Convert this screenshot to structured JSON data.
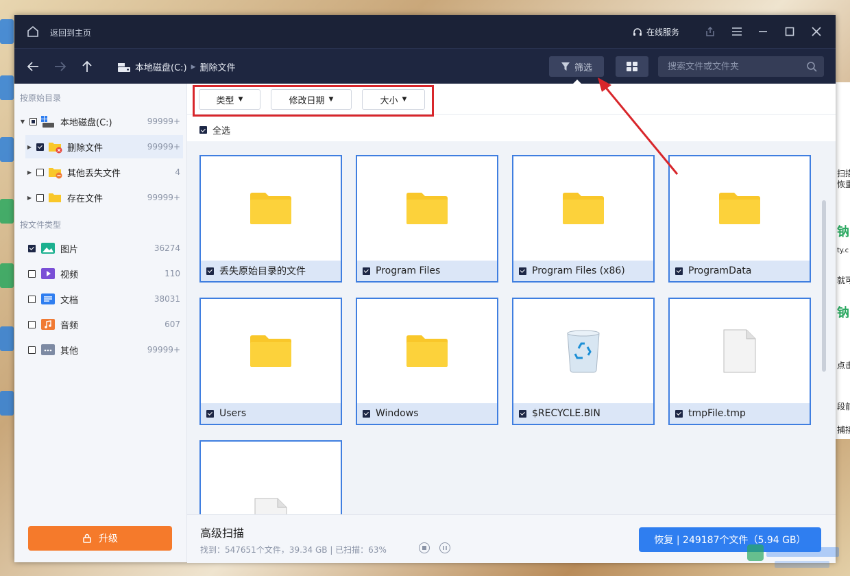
{
  "titlebar": {
    "back_home": "返回到主页",
    "service": "在线服务"
  },
  "navbar": {
    "crumbs": [
      "本地磁盘(C:)",
      "删除文件"
    ],
    "filter_label": "筛选",
    "search_placeholder": "搜索文件或文件夹"
  },
  "sidebar": {
    "section_dir": "按原始目录",
    "tree": [
      {
        "label": "本地磁盘(C:)",
        "count": "99999+"
      },
      {
        "label": "删除文件",
        "count": "99999+"
      },
      {
        "label": "其他丢失文件",
        "count": "4"
      },
      {
        "label": "存在文件",
        "count": "99999+"
      }
    ],
    "section_type": "按文件类型",
    "types": [
      {
        "label": "图片",
        "count": "36274"
      },
      {
        "label": "视频",
        "count": "110"
      },
      {
        "label": "文档",
        "count": "38031"
      },
      {
        "label": "音频",
        "count": "607"
      },
      {
        "label": "其他",
        "count": "99999+"
      }
    ],
    "upgrade": "升级"
  },
  "filters": {
    "type": "类型",
    "date": "修改日期",
    "size": "大小",
    "select_all": "全选"
  },
  "items": [
    {
      "name": "丢失原始目录的文件",
      "kind": "folder"
    },
    {
      "name": "Program Files",
      "kind": "folder"
    },
    {
      "name": "Program Files (x86)",
      "kind": "folder"
    },
    {
      "name": "ProgramData",
      "kind": "folder"
    },
    {
      "name": "Users",
      "kind": "folder"
    },
    {
      "name": "Windows",
      "kind": "folder"
    },
    {
      "name": "$RECYCLE.BIN",
      "kind": "recycle-bin"
    },
    {
      "name": "tmpFile.tmp",
      "kind": "file"
    },
    {
      "name": "",
      "kind": "file"
    }
  ],
  "bottom": {
    "title": "高级扫描",
    "stats": "找到：547651个文件，39.34 GB | 已扫描：63%",
    "recover": "恢复 | 249187个文件（5.94 GB）"
  },
  "background": {
    "right_texts": [
      "扫描",
      "恢重",
      "钠",
      "ty.c",
      "就可",
      "钠",
      "点击",
      "段前",
      "捕接"
    ]
  },
  "colors": {
    "titlebar": "#1b2237",
    "accent": "#2f7ef0",
    "upgrade": "#f57a2b",
    "annotation": "#d8262b",
    "folder": "#f9c72a"
  }
}
